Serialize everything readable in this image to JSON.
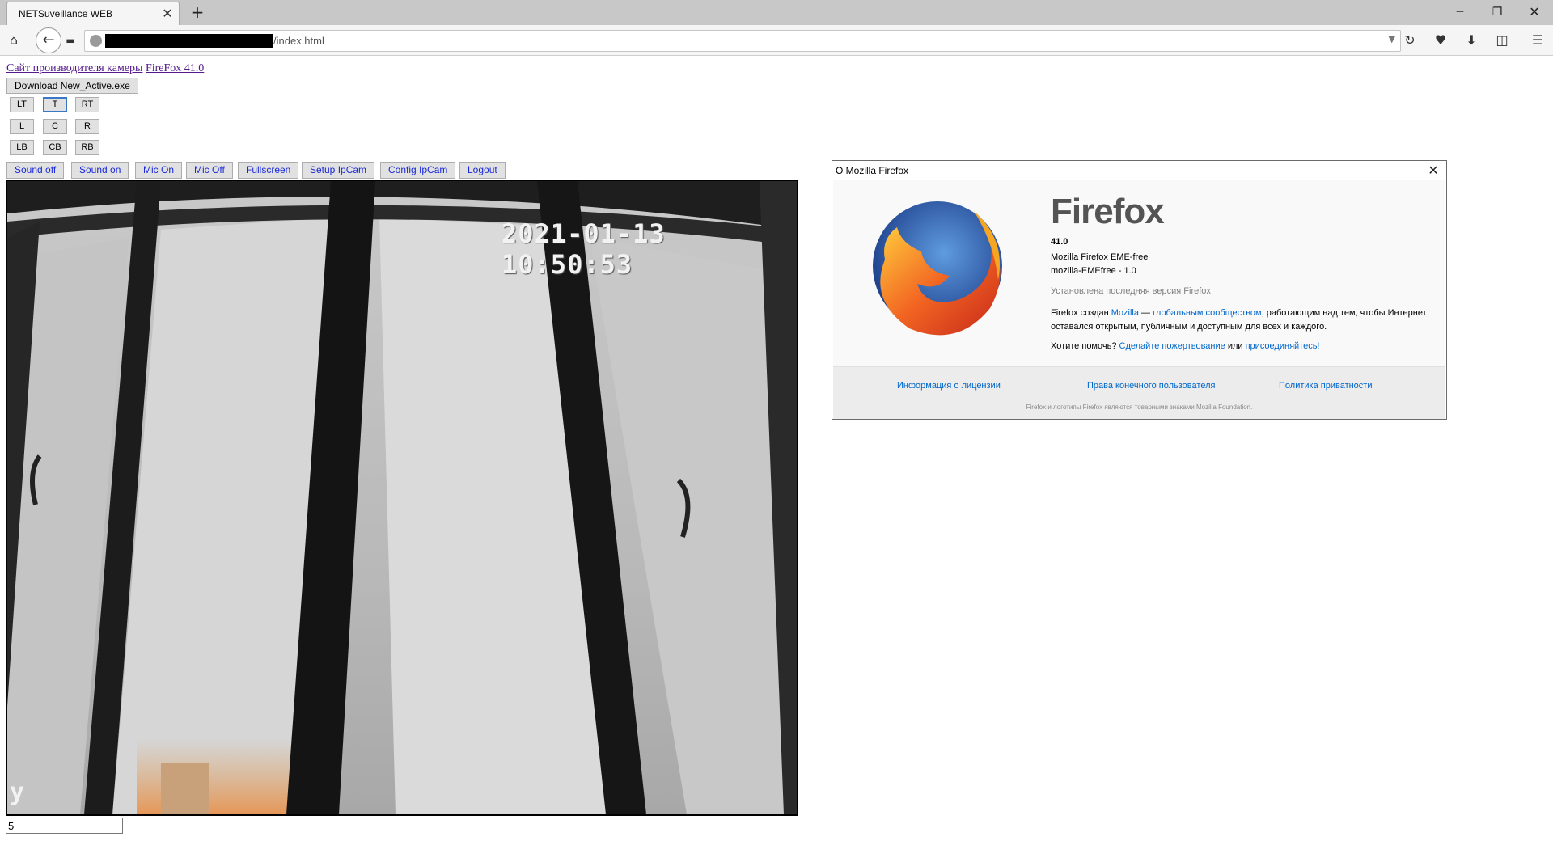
{
  "browser": {
    "tab_title": "NETSuveillance WEB",
    "tab_close": "✕",
    "new_tab": "+",
    "window_min": "─",
    "window_max": "❐",
    "window_close": "✕",
    "url_suffix": "/index.html",
    "icons": {
      "home": "⌂",
      "back": "←",
      "page": "▬",
      "dropdown": "▼",
      "reload": "↻",
      "pocket": "♥",
      "download": "⬇",
      "sidebar": "◫",
      "menu": "☰"
    }
  },
  "page": {
    "link_vendor": "Сайт производителя камеры",
    "link_firefox": "FireFox 41.0",
    "download_button": "Download New_Active.exe",
    "ptz": {
      "lt": "LT",
      "t": "T",
      "rt": "RT",
      "l": "L",
      "c": "C",
      "r": "R",
      "lb": "LB",
      "cb": "CB",
      "rb": "RB"
    },
    "controls": {
      "sound_off": "Sound off",
      "sound_on": "Sound on",
      "mic_on": "Mic On",
      "mic_off": "Mic Off",
      "fullscreen": "Fullscreen",
      "setup": "Setup IpCam",
      "config": "Config IpCam",
      "logout": "Logout"
    },
    "video": {
      "timestamp": "2021-01-13 10:50:53",
      "osd_label": "y"
    },
    "input_value": "5"
  },
  "about_dialog": {
    "title": "О Mozilla Firefox",
    "close": "✕",
    "brand": "Firefox",
    "version": "41.0",
    "distribution": "Mozilla Firefox EME-free",
    "distribution_id": "mozilla-EMEfree - 1.0",
    "update_status": "Установлена последняя версия Firefox",
    "community_pre": "Firefox создан ",
    "community_link1": "Mozilla",
    "community_mid": " — ",
    "community_link2": "глобальным сообществом",
    "community_post": ", работающим над тем, чтобы Интернет оставался открытым, публичным и доступным для всех и каждого.",
    "help_pre": "Хотите помочь? ",
    "help_link1": "Сделайте пожертвование",
    "help_mid": " или ",
    "help_link2": "присоединяйтесь!",
    "footer_license": "Информация о лицензии",
    "footer_eula": "Права конечного пользователя",
    "footer_privacy": "Политика приватности",
    "trademark": "Firefox и логотипы Firefox являются товарными знаками Mozilla Foundation."
  }
}
